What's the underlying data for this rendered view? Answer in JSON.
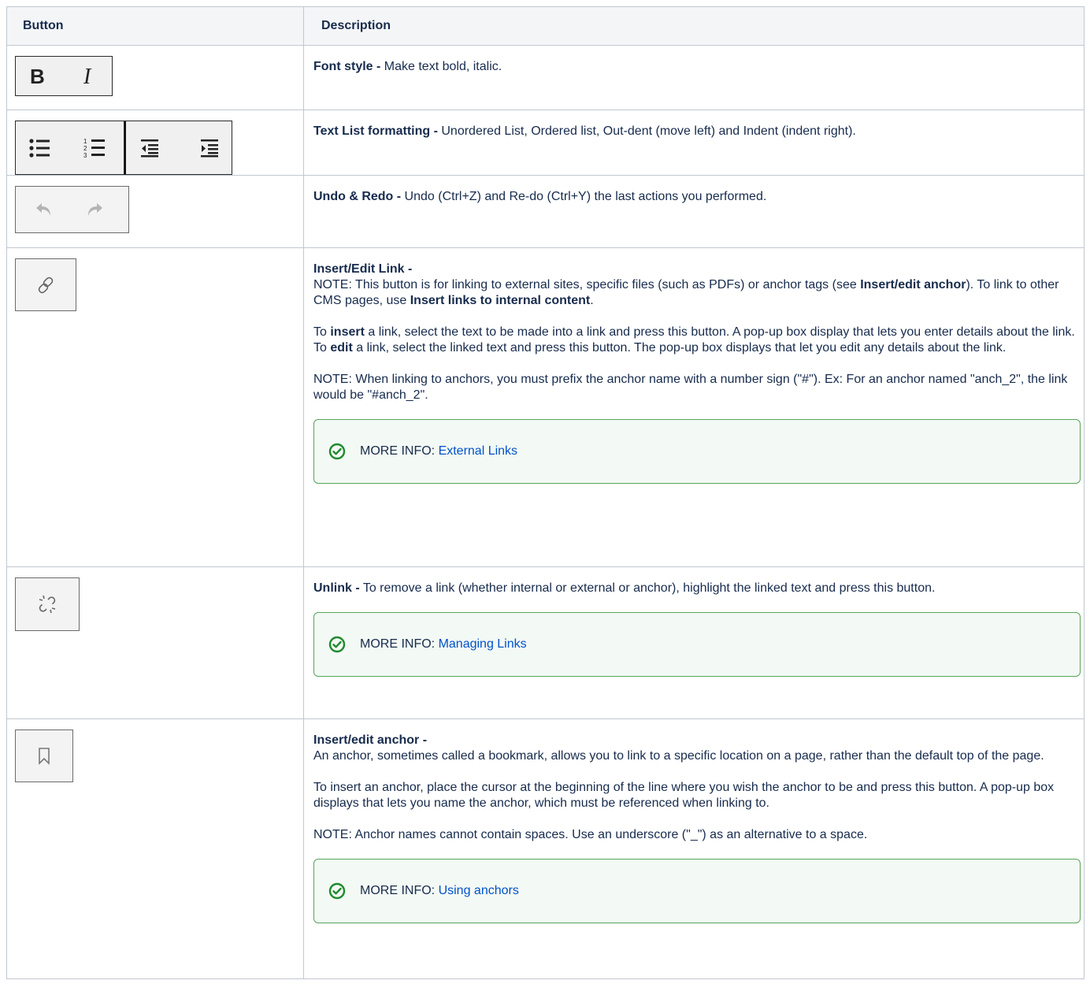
{
  "table": {
    "headers": {
      "button": "Button",
      "description": "Description"
    },
    "rows": {
      "font_style": {
        "title": "Font style -",
        "text": " Make text bold, italic.",
        "icons": [
          "bold-icon",
          "italic-icon"
        ]
      },
      "lists": {
        "title": "Text List formatting -",
        "text": " Unordered List, Ordered list, Out-dent (move left) and Indent (indent right).",
        "icons": [
          "bullet-list-icon",
          "numbered-list-icon",
          "outdent-icon",
          "indent-icon"
        ]
      },
      "undo": {
        "title": "Undo & Redo -",
        "text": " Undo (Ctrl+Z) and Re-do (Ctrl+Y) the last actions you performed.",
        "icons": [
          "undo-icon",
          "redo-icon"
        ]
      },
      "link": {
        "title": "Insert/Edit Link -",
        "note1_a": "NOTE: This button is for linking to external sites, specific files (such as PDFs) or anchor tags (see ",
        "note1_b": "Insert/edit anchor",
        "note1_c": "). To link to other CMS pages, use ",
        "note1_d": "Insert links to internal content",
        "note1_e": ".",
        "p2_a": "To ",
        "p2_b": "insert",
        "p2_c": " a link, select the text to be made into a link and press this button. A pop-up box display that lets you enter details about the link.",
        "p2_d": "To ",
        "p2_e": "edit",
        "p2_f": " a link, select the linked text and press this button. The pop-up box displays that let you edit any details about the link.",
        "p3": "NOTE: When linking to anchors, you must prefix the anchor name with a number sign (\"#\"). Ex: For an anchor named \"anch_2\", the link would be \"#anch_2\".",
        "info_label": "MORE INFO: ",
        "info_link": "External Links",
        "icons": [
          "link-icon"
        ]
      },
      "unlink": {
        "title": "Unlink -",
        "text": " To remove a link (whether internal or external or anchor), highlight the linked text and press this button.",
        "info_label": "MORE INFO: ",
        "info_link": "Managing Links",
        "icons": [
          "unlink-icon"
        ]
      },
      "anchor": {
        "title": "Insert/edit anchor -",
        "p1": "An anchor, sometimes called a bookmark, allows you to link to a specific location on a page, rather than the default top of the page.",
        "p2": "To insert an anchor, place the cursor at the beginning of the line where you wish the anchor to be and press this button. A pop-up box displays that lets you name the anchor, which must be referenced when linking to.",
        "p3": "NOTE: Anchor names cannot contain spaces. Use an underscore (\"_\") as an alternative to a space.",
        "info_label": "MORE INFO: ",
        "info_link": "Using anchors",
        "icons": [
          "bookmark-icon"
        ]
      }
    }
  },
  "colors": {
    "border": "#c1c7d0",
    "header_bg": "#f4f5f7",
    "link": "#0052cc",
    "info_border": "#57a55a",
    "info_bg": "#f3f9f4",
    "check": "#1f8a2e"
  }
}
